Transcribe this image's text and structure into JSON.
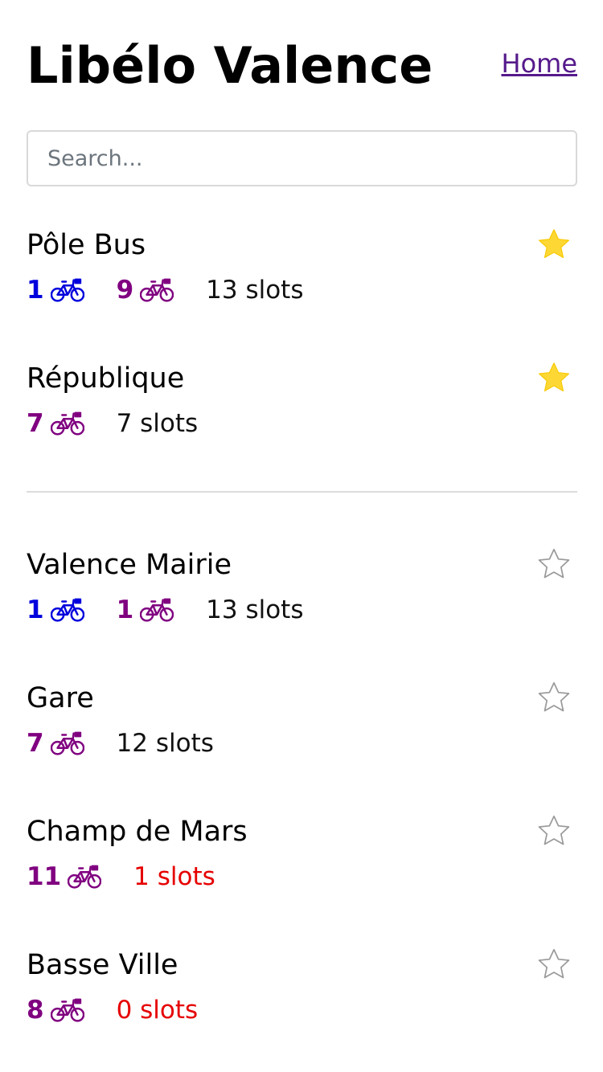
{
  "app": {
    "title": "Libélo Valence",
    "home_link": "Home"
  },
  "search": {
    "placeholder": "Search...",
    "value": ""
  },
  "colors": {
    "electric": "#0000dd",
    "mechanical": "#800080",
    "low_slots": "#e60000",
    "star_filled": "#fdd835"
  },
  "favorites": [
    {
      "name": "Pôle Bus",
      "electric": "1",
      "mechanical": "9",
      "slots": "13 slots",
      "starred": true
    },
    {
      "name": "République",
      "mechanical": "7",
      "slots": "7 slots",
      "starred": true
    }
  ],
  "stations": [
    {
      "name": "Valence Mairie",
      "electric": "1",
      "mechanical": "1",
      "slots": "13 slots",
      "starred": false
    },
    {
      "name": "Gare",
      "mechanical": "7",
      "slots": "12 slots",
      "starred": false
    },
    {
      "name": "Champ de Mars",
      "mechanical": "11",
      "slots": "1 slots",
      "starred": false
    },
    {
      "name": "Basse Ville",
      "mechanical": "8",
      "slots": "0 slots",
      "starred": false
    }
  ]
}
